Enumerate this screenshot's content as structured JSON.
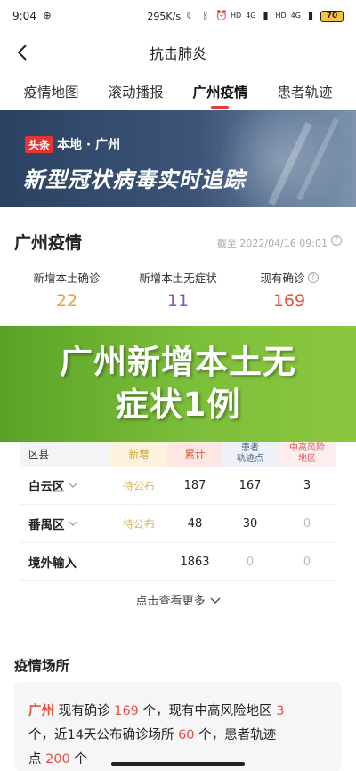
{
  "status_bar": {
    "time": "9:04",
    "speed": "295K/s",
    "network_1": "4G",
    "network_2": "4G",
    "battery": "70",
    "hd_1": "HD",
    "hd_2": "HD"
  },
  "header": {
    "title": "抗击肺炎"
  },
  "tabs": [
    {
      "label": "疫情地图",
      "active": false
    },
    {
      "label": "滚动播报",
      "active": false
    },
    {
      "label": "广州疫情",
      "active": true
    },
    {
      "label": "患者轨迹",
      "active": false
    }
  ],
  "banner": {
    "tag": "头条",
    "tag_text": "本地 · 广州",
    "title": "新型冠状病毒实时追踪"
  },
  "stats": {
    "title": "广州疫情",
    "as_of": "截至 2022/04/16 09:01",
    "items": [
      {
        "label": "新增本土确诊",
        "value": "22",
        "color": "#e2a431"
      },
      {
        "label": "新增本土无症状",
        "value": "11",
        "color": "#8a52b4"
      },
      {
        "label": "现有确诊",
        "value": "169",
        "color": "#e2533e"
      }
    ]
  },
  "overlay": {
    "text": "广州新增本土无症状1例",
    "bg_color": "#7cbf3a"
  },
  "table": {
    "headers": {
      "district": "区县",
      "new": "新增",
      "cumulative": "累计",
      "tracked": "患者\n轨迹点",
      "risk": "中高风险\n地区"
    },
    "rows": [
      {
        "district": "白云区",
        "new": "待公布",
        "cumulative": "187",
        "tracked": "167",
        "risk": "3",
        "expandable": true
      },
      {
        "district": "番禺区",
        "new": "待公布",
        "cumulative": "48",
        "tracked": "30",
        "risk": "0",
        "expandable": true
      },
      {
        "district": "境外输入",
        "new": "",
        "cumulative": "1863",
        "tracked": "0",
        "risk": "0",
        "expandable": false
      }
    ],
    "more": "点击查看更多"
  },
  "places": {
    "title": "疫情场所",
    "line1_city": "广州",
    "line1_a": " 现有确诊 ",
    "line1_n1": "169",
    "line1_b": " 个，现有中高风险地区 ",
    "line1_n2": "3",
    "line2_a": "个，近14天公布确诊场所 ",
    "line2_n": "60",
    "line2_b": " 个，患者轨迹",
    "line3_a": "点 ",
    "line3_n": "200",
    "line3_b": " 个"
  }
}
